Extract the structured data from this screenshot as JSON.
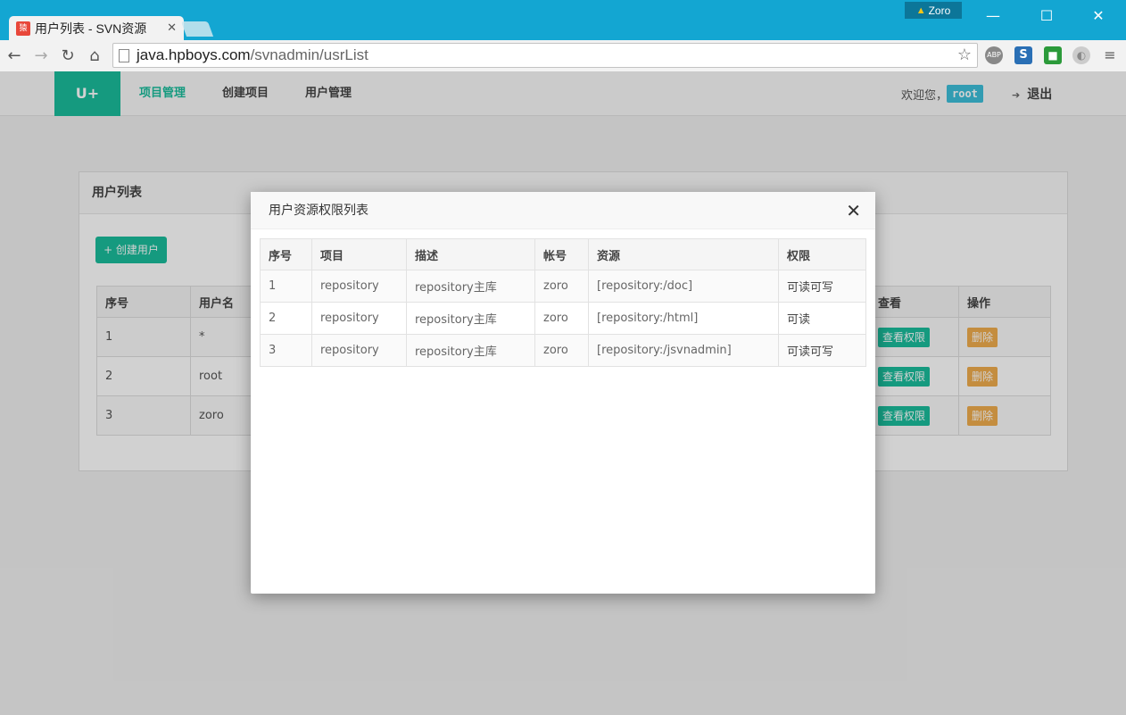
{
  "browser": {
    "tab_title": "用户列表 - SVN资源",
    "tab_favicon": "猿",
    "profile_name": "Zoro",
    "url_host": "java.hpboys.com",
    "url_path": "/svnadmin/usrList",
    "extensions": [
      "ABP",
      "S",
      "■",
      "◐"
    ]
  },
  "nav": {
    "brand": "U+",
    "links": [
      "项目管理",
      "创建项目",
      "用户管理"
    ],
    "active_link": "项目管理",
    "welcome": "欢迎您，",
    "user": "root",
    "logout": "退出"
  },
  "user_panel": {
    "title": "用户列表",
    "create_button": "+ 创建用户",
    "columns": [
      "序号",
      "用户名",
      "查看",
      "操作"
    ],
    "rows": [
      {
        "index": "1",
        "name": "*",
        "view": "查看权限",
        "delete": "删除"
      },
      {
        "index": "2",
        "name": "root",
        "view": "查看权限",
        "delete": "删除"
      },
      {
        "index": "3",
        "name": "zoro",
        "view": "查看权限",
        "delete": "删除"
      }
    ]
  },
  "modal": {
    "title": "用户资源权限列表",
    "columns": [
      "序号",
      "项目",
      "描述",
      "帐号",
      "资源",
      "权限"
    ],
    "rows": [
      {
        "index": "1",
        "project": "repository",
        "desc": "repository主库",
        "account": "zoro",
        "resource": "[repository:/doc]",
        "perm": "可读可写"
      },
      {
        "index": "2",
        "project": "repository",
        "desc": "repository主库",
        "account": "zoro",
        "resource": "[repository:/html]",
        "perm": "可读"
      },
      {
        "index": "3",
        "project": "repository",
        "desc": "repository主库",
        "account": "zoro",
        "resource": "[repository:/jsvnadmin]",
        "perm": "可读可写"
      }
    ]
  },
  "colors": {
    "titlebar": "#13a6d2",
    "accent": "#1abc9c",
    "danger": "#f0ad4e",
    "user_badge": "#3dbfd9"
  },
  "icons": [
    "back-arrow-icon",
    "forward-arrow-icon",
    "reload-icon",
    "home-icon",
    "star-icon",
    "menu-icon",
    "close-icon",
    "logout-icon",
    "warning-icon"
  ]
}
